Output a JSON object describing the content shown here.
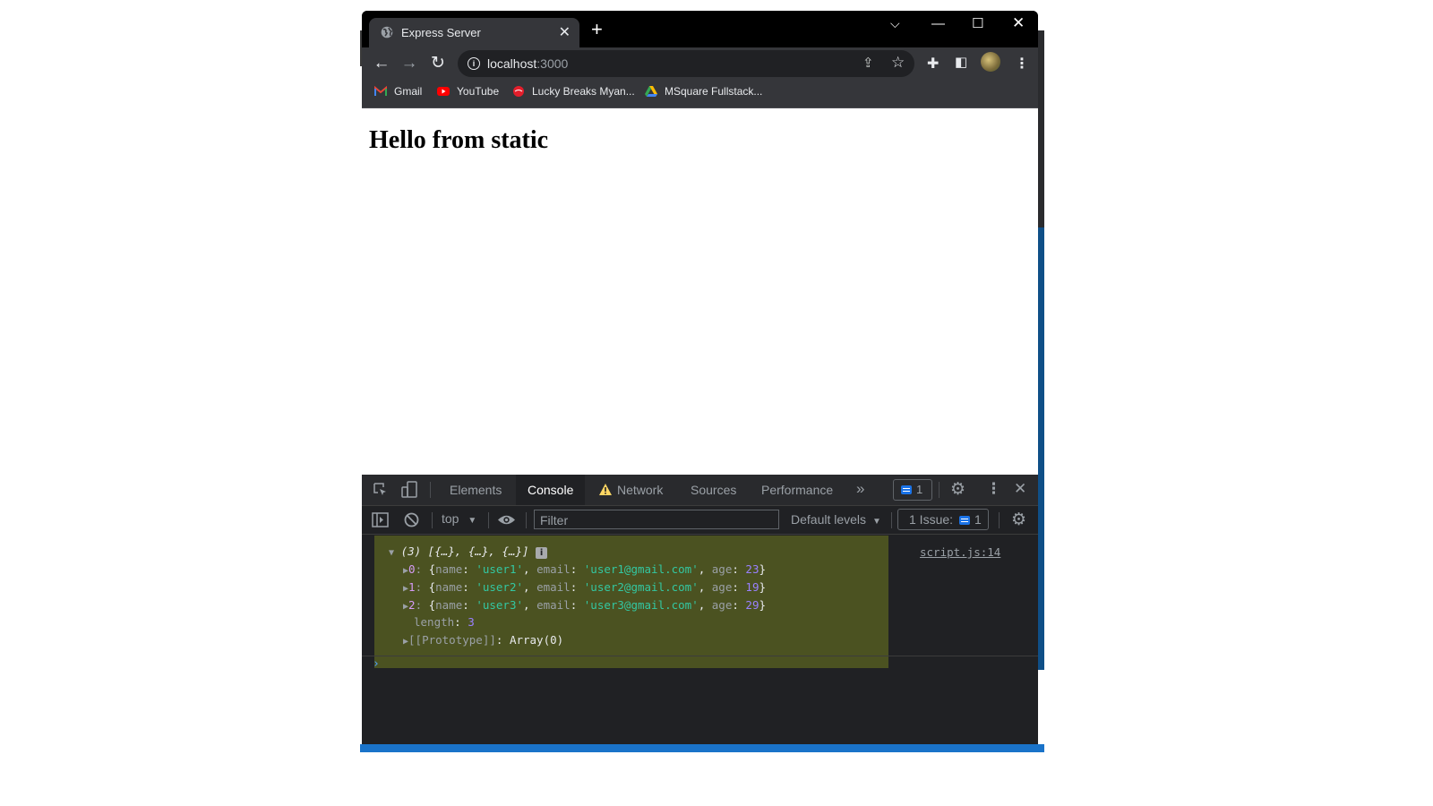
{
  "browser": {
    "tab_title": "Express Server",
    "tab_close": "✕",
    "new_tab": "+",
    "url_host": "localhost",
    "url_port": ":3000"
  },
  "bookmarks": [
    {
      "label": "Gmail",
      "icon": "gmail-icon"
    },
    {
      "label": "YouTube",
      "icon": "youtube-icon"
    },
    {
      "label": "Lucky Breaks Myan...",
      "icon": "coca-cola-icon"
    },
    {
      "label": "MSquare Fullstack...",
      "icon": "google-drive-icon"
    }
  ],
  "page": {
    "heading": "Hello from static"
  },
  "devtools": {
    "tabs": [
      "Elements",
      "Console",
      "Network",
      "Sources",
      "Performance"
    ],
    "active_tab": "Console",
    "more_tabs": "»",
    "messages_count": "1",
    "context": "top",
    "filter_placeholder": "Filter",
    "levels": "Default levels",
    "issues_label": "1 Issue:",
    "issues_count": "1"
  },
  "console": {
    "source_link": "script.js:14",
    "array_summary": "(3) [{…}, {…}, {…}]",
    "info_badge": "i",
    "items": [
      {
        "index": "0",
        "name": "'user1'",
        "email": "'user1@gmail.com'",
        "age": "23"
      },
      {
        "index": "1",
        "name": "'user2'",
        "email": "'user2@gmail.com'",
        "age": "19"
      },
      {
        "index": "2",
        "name": "'user3'",
        "email": "'user3@gmail.com'",
        "age": "29"
      }
    ],
    "length_key": "length",
    "length_value": "3",
    "prototype_key": "[[Prototype]]",
    "prototype_value": "Array(0)",
    "prompt": "›"
  },
  "colors": {
    "devtools_bg": "#202124",
    "highlight": "#4b5221",
    "string": "#5cd5fb",
    "number": "#9980ff",
    "accent": "#1a73e8"
  }
}
